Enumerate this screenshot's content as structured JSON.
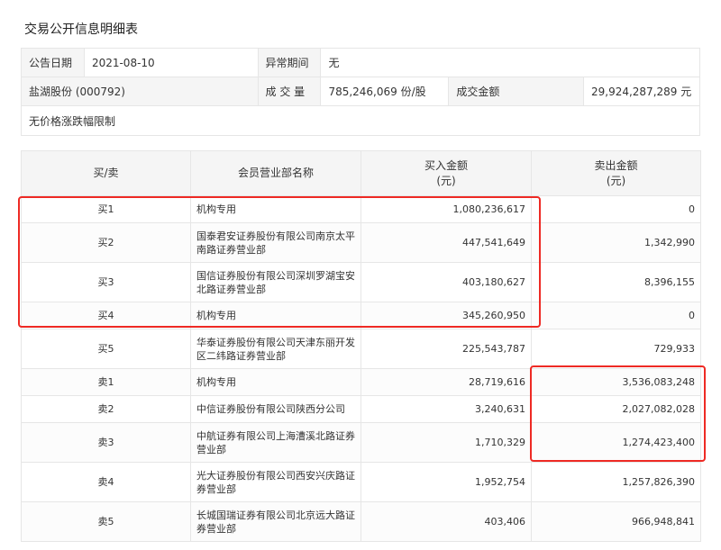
{
  "title": "交易公开信息明细表",
  "info": {
    "date_label": "公告日期",
    "date_value": "2021-08-10",
    "abnormal_label": "异常期间",
    "abnormal_value": "无",
    "stock_value": "盐湖股份 (000792)",
    "volume_label": "成 交 量",
    "volume_value": "785,246,069 份/股",
    "amount_label": "成交金额",
    "amount_value": "29,924,287,289 元",
    "limit_text": "无价格涨跌幅限制"
  },
  "table": {
    "headers": {
      "side": "买/卖",
      "broker": "会员营业部名称",
      "buy_1": "买入金额",
      "buy_2": "(元)",
      "sell_1": "卖出金额",
      "sell_2": "(元)"
    },
    "rows": [
      {
        "side": "买1",
        "broker": "机构专用",
        "buy": "1,080,236,617",
        "sell": "0"
      },
      {
        "side": "买2",
        "broker": "国泰君安证券股份有限公司南京太平南路证券营业部",
        "buy": "447,541,649",
        "sell": "1,342,990"
      },
      {
        "side": "买3",
        "broker": "国信证券股份有限公司深圳罗湖宝安北路证券营业部",
        "buy": "403,180,627",
        "sell": "8,396,155"
      },
      {
        "side": "买4",
        "broker": "机构专用",
        "buy": "345,260,950",
        "sell": "0"
      },
      {
        "side": "买5",
        "broker": "华泰证券股份有限公司天津东丽开发区二纬路证券营业部",
        "buy": "225,543,787",
        "sell": "729,933"
      },
      {
        "side": "卖1",
        "broker": "机构专用",
        "buy": "28,719,616",
        "sell": "3,536,083,248"
      },
      {
        "side": "卖2",
        "broker": "中信证券股份有限公司陕西分公司",
        "buy": "3,240,631",
        "sell": "2,027,082,028"
      },
      {
        "side": "卖3",
        "broker": "中航证券有限公司上海漕溪北路证券营业部",
        "buy": "1,710,329",
        "sell": "1,274,423,400"
      },
      {
        "side": "卖4",
        "broker": "光大证券股份有限公司西安兴庆路证券营业部",
        "buy": "1,952,754",
        "sell": "1,257,826,390"
      },
      {
        "side": "卖5",
        "broker": "长城国瑞证券有限公司北京远大路证券营业部",
        "buy": "403,406",
        "sell": "966,948,841"
      }
    ]
  },
  "highlight_color": "#ee2a24"
}
